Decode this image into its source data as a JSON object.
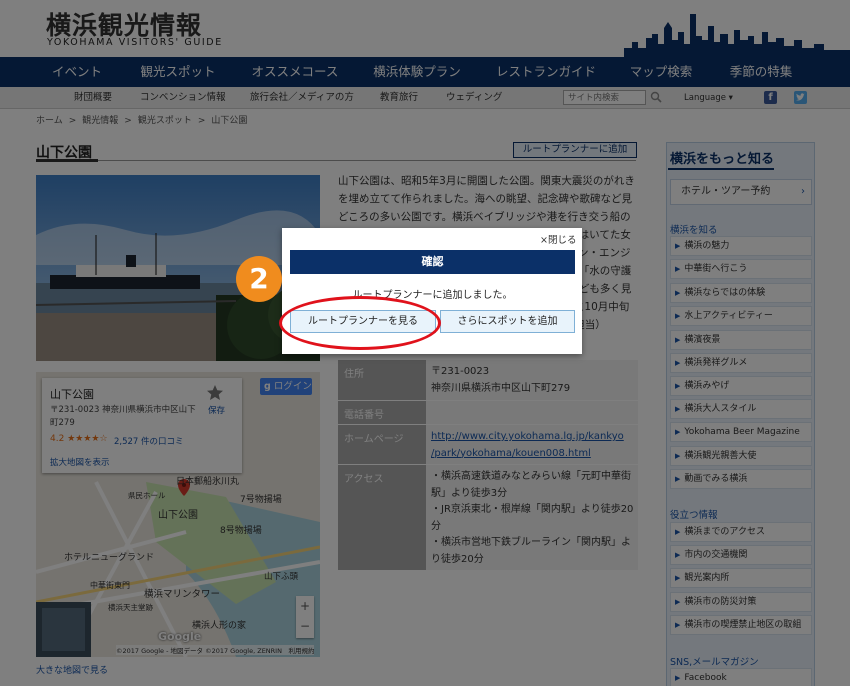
{
  "header": {
    "logo_ja": "横浜観光情報",
    "logo_en": "YOKOHAMA VISITORS' GUIDE",
    "nav": [
      "イベント",
      "観光スポット",
      "オススメコース",
      "横浜体験プラン",
      "レストランガイド",
      "マップ検索",
      "季節の特集"
    ],
    "subnav": [
      "財団概要",
      "コンベンション情報",
      "旅行会社／メディアの方",
      "教育旅行",
      "ウェディング"
    ],
    "search_placeholder": "サイト内検索",
    "language": "Language ▾",
    "facebook_glyph": "f"
  },
  "breadcrumb": [
    "ホーム",
    ">",
    "観光情報",
    ">",
    "観光スポット",
    ">",
    "山下公園"
  ],
  "main": {
    "title": "山下公園",
    "add_planner": "ルートプランナーに追加",
    "description": "山下公園は、昭和5年3月に開園した公園。関東大震災のがれきを埋め立てて作られました。海への眺望、記念碑や歌碑など見どころの多い公園です。横浜ベイブリッジや港を行き交う船の眺めがロマンチック。童謡で親しみの深い「赤い靴はいてた女の子」像や、在日米軍から寄贈された「ガーディアン・エンジェル」の像、姉妹都市サンディエゴ市から贈られた「水の守護神」の像など、海外との交流を感じさせる記念碑なども多く見どころです。また、バラ園も人気で、毎年5月中旬と10月中旬がバラの時期に（世界の広場、臨港線跡に）（公園担当）",
    "map": {
      "name": "山下公園",
      "address": "〒231-0023 神奈川県横浜市中区山下町279",
      "rating": "4.2",
      "stars": "★★★★☆",
      "reviews": "2,527 件の口コミ",
      "save": "保存",
      "enlarge": "拡大地図を表示",
      "login": "ログイン",
      "login_glyph": "g",
      "zoom_in": "+",
      "zoom_out": "−",
      "google": "Google",
      "credit": "©2017 Google - 地図データ ©2017 Google, ZENRIN　利用規約",
      "labels": [
        "日本郵船氷川丸",
        "山下公園",
        "7号物揚場",
        "8号物揚場",
        "ホテルニューグランド",
        "横浜マリンタワー",
        "横浜人形の家",
        "山下ふ頭",
        "中華街東門",
        "横浜天主堂跡",
        "県民ホール"
      ]
    },
    "big_map": "大きな地図で見る",
    "info": [
      {
        "head": "住所",
        "lines": [
          "〒231-0023",
          "神奈川県横浜市中区山下町279"
        ]
      },
      {
        "head": "電話番号",
        "lines": [
          ""
        ]
      },
      {
        "head": "ホームページ",
        "lines": [
          "http://www.city.yokohama.lg.jp/kankyo",
          "/park/yokohama/kouen008.html"
        ]
      },
      {
        "head": "アクセス",
        "lines": [
          "・横浜高速鉄道みなとみらい線「元町中華街",
          "駅」より徒歩3分",
          "・JR京浜東北・根岸線「関内駅」より徒歩20",
          "分",
          "・横浜市営地下鉄ブルーライン「関内駅」よ",
          "り徒歩20分"
        ]
      }
    ]
  },
  "sidebar": {
    "title": "横浜をもっと知る",
    "hotel": "ホテル・ツアー予約",
    "cat1": "横浜を知る",
    "items1": [
      "横浜の魅力",
      "中華街へ行こう",
      "横浜ならではの体験",
      "水上アクティビティー",
      "横濱夜景",
      "横浜発祥グルメ",
      "横浜みやげ",
      "横浜大人スタイル",
      "Yokohama Beer Magazine",
      "横浜観光親善大使",
      "動画でみる横浜"
    ],
    "cat2": "役立つ情報",
    "items2": [
      "横浜までのアクセス",
      "市内の交通機関",
      "観光案内所",
      "横浜市の防災対策",
      "横浜市の喫煙禁止地区の取組"
    ],
    "cat3": "SNS,メールマガジン",
    "items3": [
      "Facebook"
    ],
    "arrow": "▶"
  },
  "modal": {
    "close": "×閉じる",
    "title": "確認",
    "message": "ルートプランナーに追加しました。",
    "view_button": "ルートプランナーを見る",
    "more_button": "さらにスポットを追加",
    "step": "2"
  }
}
